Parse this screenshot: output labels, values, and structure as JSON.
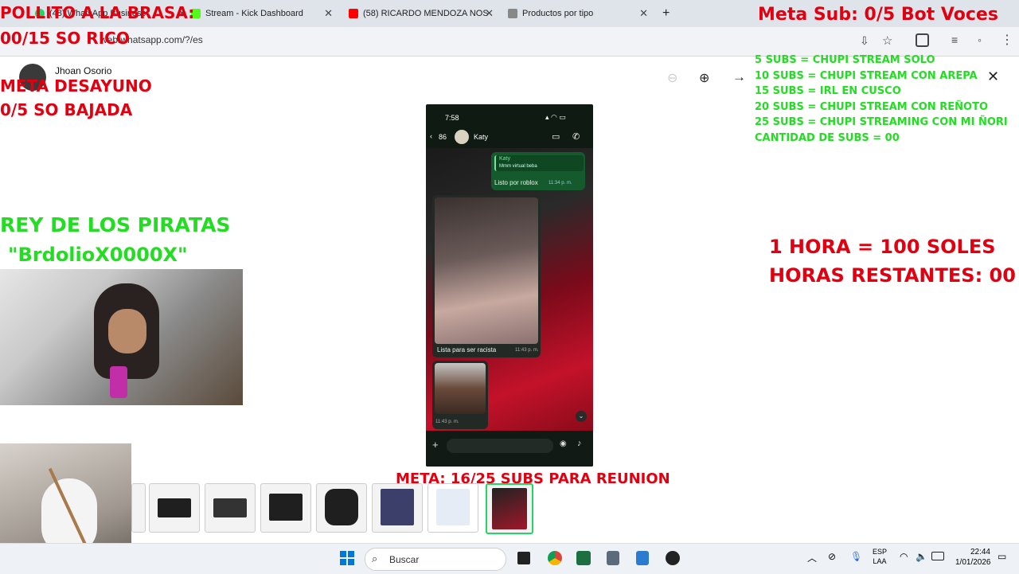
{
  "browser": {
    "tabs": [
      {
        "label": "(48) WhatsApp Business",
        "favicon_color": "#25d366"
      },
      {
        "label": "Stream - Kick Dashboard",
        "favicon_color": "#53fc18"
      },
      {
        "label": "(58) RICARDO MENDOZA NOS",
        "favicon_color": "#ff0000"
      },
      {
        "label": "Productos por tipo",
        "favicon_color": "#888888"
      }
    ],
    "new_tab": "+",
    "close": "✕",
    "url": "web.whatsapp.com/?/es"
  },
  "whatsapp": {
    "contact_name": "Jhoan Osorio"
  },
  "overlays": {
    "pollito": "POLLITO A LA BRASA:",
    "pollito_count": "00/15 SO RICO",
    "meta_desayuno": "META DESAYUNO",
    "meta_desayuno_count": "0/5 SO BAJADA",
    "rey_title": "REY DE LOS PIRATAS",
    "rey_name": "\"BrdolioX0000X\"",
    "meta_sub": "Meta Sub: 0/5 Bot Voces",
    "subs_list": [
      "5 SUBS = CHUPI STREAM SOLO",
      "10 SUBS = CHUPI STREAM CON AREPA",
      "15 SUBS = IRL EN CUSCO",
      "20 SUBS = CHUPI STREAM CON REÑOTO",
      "25 SUBS = CHUPI STREAMING CON MI ÑORI",
      "CANTIDAD DE SUBS = 00"
    ],
    "hora_rate": "1 HORA = 100 SOLES",
    "horas_restantes": "HORAS RESTANTES: 00",
    "meta_reunion": "META: 16/25 SUBS PARA REUNION"
  },
  "phone": {
    "time": "7:58",
    "back_count": "86",
    "chat_name": "Katy",
    "quote_author": "Katy",
    "quote_text": "Mmm virtual beba",
    "msg_out": "Listo por roblox",
    "msg_out_time": "11:34 p. m.",
    "msg_in_caption": "Lista para ser racista",
    "msg_in_time": "11:43 p. m.",
    "msg_in2_time": "11:43 p. m."
  },
  "taskbar": {
    "search_placeholder": "Buscar",
    "lang_top": "ESP",
    "lang_bottom": "LAA",
    "clock_time": "22:44",
    "clock_date": "1/01/2026"
  },
  "colors": {
    "overlay_red": "#e00010",
    "overlay_green": "#22dd22",
    "whatsapp_green": "#25d366"
  }
}
